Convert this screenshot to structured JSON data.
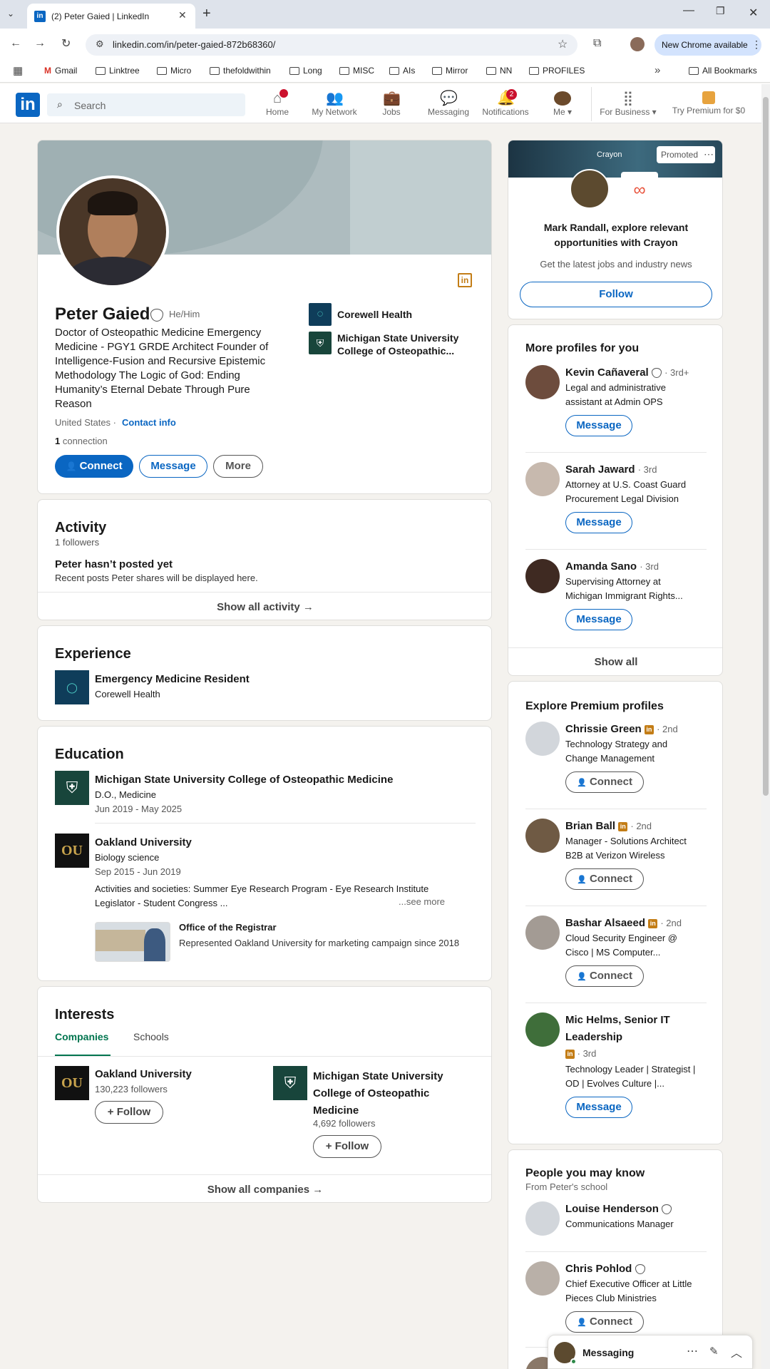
{
  "browser": {
    "tab_title": "(2) Peter Gaied | LinkedIn",
    "url": "linkedin.com/in/peter-gaied-872b68360/",
    "update_label": "New Chrome available",
    "bookmarks": [
      "Gmail",
      "Linktree",
      "Micro",
      "thefoldwithin",
      "Long",
      "MISC",
      "AIs",
      "Mirror",
      "NN",
      "PROFILES"
    ],
    "all_bookmarks": "All Bookmarks"
  },
  "nav": {
    "search_placeholder": "Search",
    "home": "Home",
    "network": "My Network",
    "jobs": "Jobs",
    "messaging": "Messaging",
    "notifications": "Notifications",
    "notifications_count": "2",
    "me": "Me",
    "business": "For Business",
    "premium": "Try Premium for $0"
  },
  "profile": {
    "name": "Peter Gaied",
    "pronouns": "He/Him",
    "headline": "Doctor of Osteopathic Medicine Emergency Medicine - PGY1 GRDE Architect Founder of Intelligence-Fusion and Recursive Epistemic Methodology The Logic of God: Ending Humanity’s Eternal Debate Through Pure Reason",
    "location": "United States ·",
    "contact": "Contact info",
    "connections_num": "1",
    "connections_label": " connection",
    "org1": "Corewell Health",
    "org2": "Michigan State University College of Osteopathic...",
    "connect": "Connect",
    "message": "Message",
    "more": "More"
  },
  "activity": {
    "title": "Activity",
    "followers": "1 followers",
    "empty_title": "Peter hasn’t posted yet",
    "empty_sub": "Recent posts Peter shares will be displayed here.",
    "show_all": "Show all activity →"
  },
  "experience": {
    "title": "Experience",
    "role": "Emergency Medicine Resident",
    "org": "Corewell Health"
  },
  "education": {
    "title": "Education",
    "items": [
      {
        "school": "Michigan State University College of Osteopathic Medicine",
        "degree": "D.O., Medicine",
        "dates": "Jun 2019 - May 2025"
      },
      {
        "school": "Oakland University",
        "degree": "Biology science",
        "dates": "Sep 2015 - Jun 2019",
        "activities": "Activities and societies: Summer Eye Research Program - Eye Research Institute Legislator - Student Congress ...",
        "see_more": "...see more",
        "media_title": "Office of the Registrar",
        "media_desc": "Represented Oakland University for marketing campaign since 2018"
      }
    ]
  },
  "interests": {
    "title": "Interests",
    "tabs": [
      "Companies",
      "Schools"
    ],
    "items": [
      {
        "name": "Oakland University",
        "followers": "130,223 followers",
        "follow": "+ Follow"
      },
      {
        "name": "Michigan State University College of Osteopathic Medicine",
        "followers": "4,692 followers",
        "follow": "+ Follow"
      }
    ],
    "show_all": "Show all companies →"
  },
  "ad": {
    "promoted": "Promoted",
    "brand": "Crayon",
    "title": "Mark Randall, explore relevant opportunities with Crayon",
    "sub": "Get the latest jobs and industry news",
    "follow": "Follow"
  },
  "more_profiles": {
    "title": "More profiles for you",
    "items": [
      {
        "name": "Kevin Cañaveral",
        "degree": "· 3rd+",
        "desc1": "Legal and administrative",
        "desc2": "assistant at Admin OPS",
        "action": "Message"
      },
      {
        "name": "Sarah Jaward",
        "degree": "· 3rd",
        "desc1": "Attorney at U.S. Coast Guard",
        "desc2": "Procurement Legal Division",
        "action": "Message"
      },
      {
        "name": "Amanda Sano",
        "degree": "· 3rd",
        "desc1": "Supervising Attorney at",
        "desc2": "Michigan Immigrant Rights...",
        "action": "Message"
      }
    ],
    "show_all": "Show all"
  },
  "premium_profiles": {
    "title": "Explore Premium profiles",
    "items": [
      {
        "name": "Chrissie Green",
        "degree": "· 2nd",
        "desc1": "Technology Strategy and",
        "desc2": "Change Management",
        "action": "Connect"
      },
      {
        "name": "Brian Ball",
        "degree": "· 2nd",
        "desc1": "Manager - Solutions Architect",
        "desc2": "B2B at Verizon Wireless",
        "action": "Connect"
      },
      {
        "name": "Bashar Alsaeed",
        "degree": "· 2nd",
        "desc1": "Cloud Security Engineer @",
        "desc2": "Cisco | MS Computer...",
        "action": "Connect"
      },
      {
        "name1": "Mic Helms, Senior IT",
        "name2": "Leadership",
        "degree": "· 3rd",
        "desc1": "Technology Leader | Strategist |",
        "desc2": "OD | Evolves Culture |...",
        "action": "Message"
      }
    ]
  },
  "pymk": {
    "title": "People you may know",
    "sub": "From Peter's school",
    "items": [
      {
        "name": "Louise Henderson",
        "desc": "Communications Manager"
      },
      {
        "name": "Chris Pohlod",
        "desc1": "Chief Executive Officer at Little",
        "desc2": "Pieces Club Ministries",
        "action": "Connect"
      }
    ]
  },
  "messaging_bar": {
    "label": "Messaging"
  },
  "colors": {
    "brand": "#0a66c2",
    "premium": "#c37d16",
    "notification": "#cb112d"
  }
}
